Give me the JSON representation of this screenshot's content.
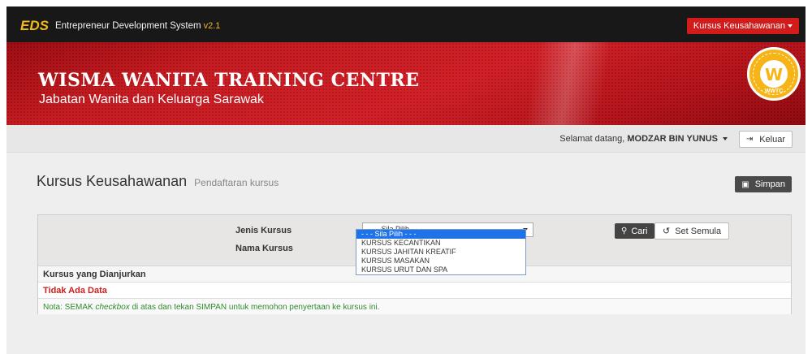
{
  "navbar": {
    "brand_logo": "EDS",
    "brand_text": "Entrepreneur Development System",
    "version": "v2.1",
    "menu_button": "Kursus Keusahawanan"
  },
  "banner": {
    "title": "WISMA WANITA TRAINING CENTRE",
    "subtitle": "Jabatan Wanita dan Keluarga Sarawak",
    "logo_letter": "W",
    "logo_tag": "WWTC"
  },
  "userbar": {
    "welcome_prefix": "Selamat datang,",
    "user_name": "MODZAR BIN YUNUS",
    "logout_label": "Keluar"
  },
  "page": {
    "title": "Kursus Keusahawanan",
    "subtitle": "Pendaftaran kursus",
    "save_label": "Simpan"
  },
  "filter": {
    "jenis_label": "Jenis Kursus",
    "nama_label": "Nama Kursus",
    "select_value": "- - - Sila Pilih - - -",
    "search_label": "Cari",
    "reset_label": "Set Semula",
    "options": [
      "- - - Sila Pilih - - -",
      "KURSUS KECANTIKAN",
      "KURSUS JAHITAN KREATIF",
      "KURSUS MASAKAN",
      "KURSUS URUT DAN SPA"
    ]
  },
  "table": {
    "header": "Kursus yang Dianjurkan",
    "empty_text": "Tidak Ada Data",
    "note_prefix": "Nota: SEMAK ",
    "note_em": "checkbox",
    "note_suffix": " di atas dan tekan SIMPAN untuk memohon penyertaan ke kursus ini."
  },
  "colors": {
    "accent_red": "#d21b1b",
    "brand_yellow": "#f3b81d",
    "dark_button": "#444444",
    "note_green": "#2e8b2e"
  }
}
